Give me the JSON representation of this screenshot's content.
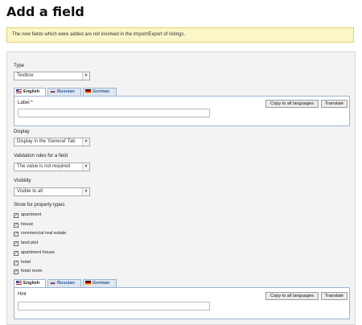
{
  "page": {
    "title": "Add a field"
  },
  "notice": {
    "text": "The new fields which were added are not involved in the Import/Export of listings."
  },
  "form": {
    "type": {
      "label": "Type",
      "value": "Textbox"
    },
    "lang_tabs": [
      {
        "label": "English",
        "flag": "flag-us"
      },
      {
        "label": "Russian",
        "flag": "flag-ru"
      },
      {
        "label": "German",
        "flag": "flag-de"
      }
    ],
    "label_field": {
      "label": "Label *",
      "value": ""
    },
    "copy_button": "Copy to all languages",
    "translate_button": "Translate",
    "display": {
      "label": "Display",
      "value": "Display in the 'General' Tab"
    },
    "validation": {
      "label": "Validation rules for a field",
      "value": "The value is not required"
    },
    "visibility": {
      "label": "Visibility",
      "value": "Visible to all"
    },
    "property_types": {
      "label": "Show for property types",
      "items": [
        {
          "label": "apartment",
          "checked": true
        },
        {
          "label": "house",
          "checked": true
        },
        {
          "label": "commercial real estate",
          "checked": true
        },
        {
          "label": "land plot",
          "checked": true
        },
        {
          "label": "apartment house",
          "checked": true
        },
        {
          "label": "hotel",
          "checked": true
        },
        {
          "label": "hotel room",
          "checked": true
        }
      ]
    },
    "hint_field": {
      "label": "Hint",
      "value": ""
    },
    "hint_copy_button": "Copy to all languages",
    "hint_translate_button": "Translate"
  }
}
